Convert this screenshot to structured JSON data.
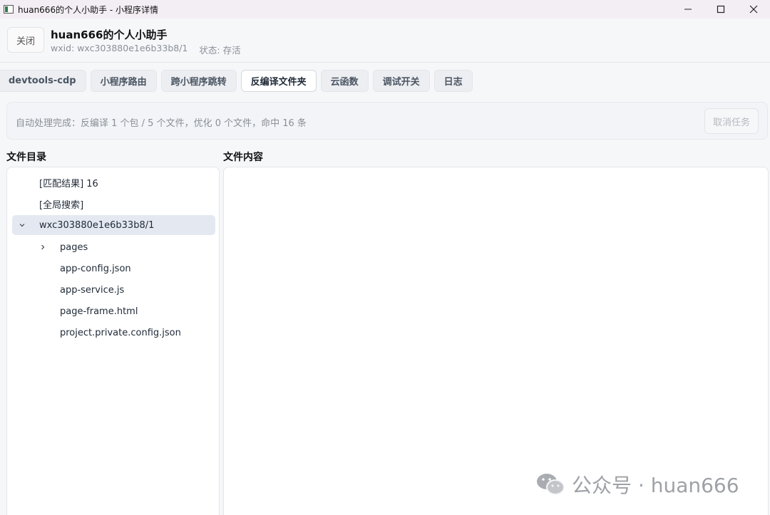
{
  "window": {
    "title": "huan666的个人小助手 - 小程序详情",
    "controls": [
      "minimize-icon",
      "maximize-icon",
      "close-icon"
    ]
  },
  "header": {
    "close_label": "关闭",
    "app_name": "huan666的个人小助手",
    "wxid": "wxid: wxc303880e1e6b33b8/1",
    "status": "状态: 存活"
  },
  "tabs": [
    {
      "label": "devtools-cdp",
      "active": false
    },
    {
      "label": "小程序路由",
      "active": false
    },
    {
      "label": "跨小程序跳转",
      "active": false
    },
    {
      "label": "反编译文件夹",
      "active": true
    },
    {
      "label": "云函数",
      "active": false
    },
    {
      "label": "调试开关",
      "active": false
    },
    {
      "label": "日志",
      "active": false
    }
  ],
  "status_panel": {
    "text": "自动处理完成：反编译 1 个包 / 5 个文件，优化 0 个文件，命中 16 条",
    "cancel_label": "取消任务"
  },
  "file_tree": {
    "heading": "文件目录",
    "items": [
      {
        "label": "[匹配结果] 16"
      },
      {
        "label": "[全局搜索]"
      },
      {
        "label": "wxc303880e1e6b33b8/1",
        "expanded": true,
        "selected": true
      },
      {
        "label": "pages",
        "expanded": false
      },
      {
        "label": "app-config.json"
      },
      {
        "label": "app-service.js"
      },
      {
        "label": "page-frame.html"
      },
      {
        "label": "project.private.config.json"
      }
    ]
  },
  "content": {
    "heading": "文件内容"
  },
  "watermark": {
    "text": "公众号 · huan666"
  }
}
